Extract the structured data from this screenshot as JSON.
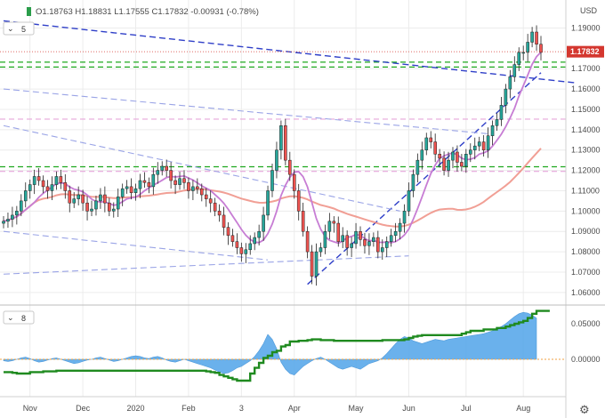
{
  "header": {
    "ohlc": "O1.18763  H1.18831  L1.17555  C1.17832  -0.00931  (-0.78%)",
    "currency": "USD",
    "main_indicator_count": "5",
    "sub_indicator_count": "8",
    "last_price_tag": "1.17832"
  },
  "colors": {
    "up": "#26a69a",
    "down": "#ef5350",
    "candle_outline": "#222222",
    "ma_fast": "#c77dd4",
    "ma_slow": "#ef8e82",
    "trend_dark": "#2f3fc8",
    "trend_light": "#9aa4e6",
    "level_green": "#1fa81f",
    "level_pink": "#e6a6da",
    "histogram": "#5aa9ea",
    "cot_line": "#1f8a1f",
    "price_tag": "#d4372f"
  },
  "chart_data": [
    {
      "type": "candlestick",
      "title": "",
      "x_tick_labels": [
        "Nov",
        "Dec",
        "2020",
        "Feb",
        "3",
        "Apr",
        "May",
        "Jun",
        "Jul",
        "Aug"
      ],
      "y_tick_labels": [
        "1.06000",
        "1.07000",
        "1.08000",
        "1.09000",
        "1.10000",
        "1.11000",
        "1.12000",
        "1.13000",
        "1.14000",
        "1.15000",
        "1.16000",
        "1.17000",
        "1.19000"
      ],
      "ylim": [
        1.056,
        1.195
      ],
      "closes": [
        1.095,
        1.096,
        1.098,
        1.1,
        1.105,
        1.11,
        1.113,
        1.117,
        1.115,
        1.112,
        1.11,
        1.113,
        1.117,
        1.114,
        1.11,
        1.104,
        1.106,
        1.108,
        1.104,
        1.1,
        1.101,
        1.105,
        1.108,
        1.104,
        1.1,
        1.101,
        1.107,
        1.111,
        1.112,
        1.109,
        1.111,
        1.115,
        1.114,
        1.112,
        1.118,
        1.12,
        1.122,
        1.12,
        1.115,
        1.113,
        1.116,
        1.114,
        1.11,
        1.112,
        1.111,
        1.108,
        1.106,
        1.104,
        1.1,
        1.098,
        1.092,
        1.088,
        1.085,
        1.082,
        1.079,
        1.081,
        1.084,
        1.087,
        1.09,
        1.098,
        1.11,
        1.12,
        1.13,
        1.142,
        1.125,
        1.118,
        1.11,
        1.1,
        1.09,
        1.08,
        1.068,
        1.08,
        1.082,
        1.09,
        1.095,
        1.094,
        1.085,
        1.088,
        1.082,
        1.084,
        1.09,
        1.086,
        1.083,
        1.085,
        1.087,
        1.08,
        1.082,
        1.085,
        1.088,
        1.09,
        1.094,
        1.1,
        1.11,
        1.118,
        1.125,
        1.13,
        1.136,
        1.134,
        1.128,
        1.126,
        1.12,
        1.125,
        1.129,
        1.124,
        1.122,
        1.128,
        1.13,
        1.132,
        1.134,
        1.13,
        1.137,
        1.142,
        1.145,
        1.152,
        1.16,
        1.166,
        1.172,
        1.178,
        1.178,
        1.183,
        1.188,
        1.182,
        1.178
      ],
      "levels_green": [
        1.1732,
        1.1708,
        1.1218
      ],
      "levels_pink": [
        1.1452,
        1.1195
      ],
      "last_price": 1.17832
    },
    {
      "type": "area",
      "title": "",
      "y_tick_labels": [
        "0.05000",
        "0.00000"
      ],
      "ylim": [
        -0.05,
        0.07
      ],
      "histogram": [
        -0.002,
        -0.003,
        -0.002,
        0.0,
        0.002,
        0.003,
        0.001,
        -0.002,
        -0.004,
        -0.003,
        -0.001,
        0.001,
        0.002,
        0.0,
        -0.002,
        -0.004,
        -0.006,
        -0.005,
        -0.003,
        -0.001,
        0.0,
        0.002,
        0.003,
        0.001,
        -0.001,
        -0.003,
        -0.002,
        0.0,
        0.002,
        0.004,
        0.005,
        0.004,
        0.002,
        0.001,
        0.003,
        0.004,
        0.002,
        -0.001,
        -0.003,
        -0.004,
        -0.002,
        0.0,
        -0.002,
        -0.004,
        -0.006,
        -0.008,
        -0.01,
        -0.012,
        -0.015,
        -0.018,
        -0.02,
        -0.019,
        -0.016,
        -0.012,
        -0.01,
        -0.006,
        -0.002,
        0.004,
        0.012,
        0.022,
        0.035,
        0.028,
        0.015,
        -0.004,
        -0.014,
        -0.02,
        -0.022,
        -0.016,
        -0.01,
        -0.006,
        -0.002,
        0.001,
        0.003,
        0.0,
        -0.004,
        -0.008,
        -0.012,
        -0.014,
        -0.012,
        -0.01,
        -0.012,
        -0.014,
        -0.01,
        -0.006,
        -0.004,
        -0.002,
        0.002,
        0.008,
        0.015,
        0.022,
        0.028,
        0.032,
        0.03,
        0.026,
        0.024,
        0.022,
        0.024,
        0.026,
        0.028,
        0.027,
        0.026,
        0.028,
        0.029,
        0.03,
        0.031,
        0.032,
        0.033,
        0.034,
        0.035,
        0.036,
        0.038,
        0.04,
        0.043,
        0.046,
        0.05,
        0.055,
        0.06,
        0.064,
        0.066,
        0.065,
        0.062,
        0.058
      ],
      "cot_line": [
        -0.018,
        -0.018,
        -0.019,
        -0.02,
        -0.02,
        -0.02,
        -0.018,
        -0.018,
        -0.018,
        -0.017,
        -0.017,
        -0.017,
        -0.016,
        -0.016,
        -0.016,
        -0.016,
        -0.016,
        -0.016,
        -0.016,
        -0.016,
        -0.016,
        -0.016,
        -0.016,
        -0.016,
        -0.016,
        -0.016,
        -0.016,
        -0.016,
        -0.016,
        -0.016,
        -0.016,
        -0.016,
        -0.016,
        -0.016,
        -0.016,
        -0.016,
        -0.016,
        -0.016,
        -0.016,
        -0.016,
        -0.016,
        -0.016,
        -0.016,
        -0.016,
        -0.016,
        -0.016,
        -0.017,
        -0.018,
        -0.019,
        -0.022,
        -0.024,
        -0.026,
        -0.028,
        -0.03,
        -0.03,
        -0.03,
        -0.02,
        -0.012,
        -0.005,
        0.002,
        0.005,
        0.01,
        0.012,
        0.018,
        0.02,
        0.025,
        0.025,
        0.026,
        0.026,
        0.027,
        0.028,
        0.028,
        0.027,
        0.027,
        0.027,
        0.026,
        0.026,
        0.026,
        0.026,
        0.026,
        0.026,
        0.026,
        0.026,
        0.026,
        0.026,
        0.026,
        0.027,
        0.027,
        0.027,
        0.027,
        0.027,
        0.028,
        0.03,
        0.032,
        0.033,
        0.034,
        0.034,
        0.034,
        0.034,
        0.034,
        0.034,
        0.034,
        0.034,
        0.034,
        0.036,
        0.038,
        0.04,
        0.04,
        0.04,
        0.042,
        0.042,
        0.042,
        0.044,
        0.044,
        0.046,
        0.048,
        0.05,
        0.052,
        0.054,
        0.058,
        0.064,
        0.068,
        0.068,
        0.068,
        0.068
      ]
    }
  ]
}
